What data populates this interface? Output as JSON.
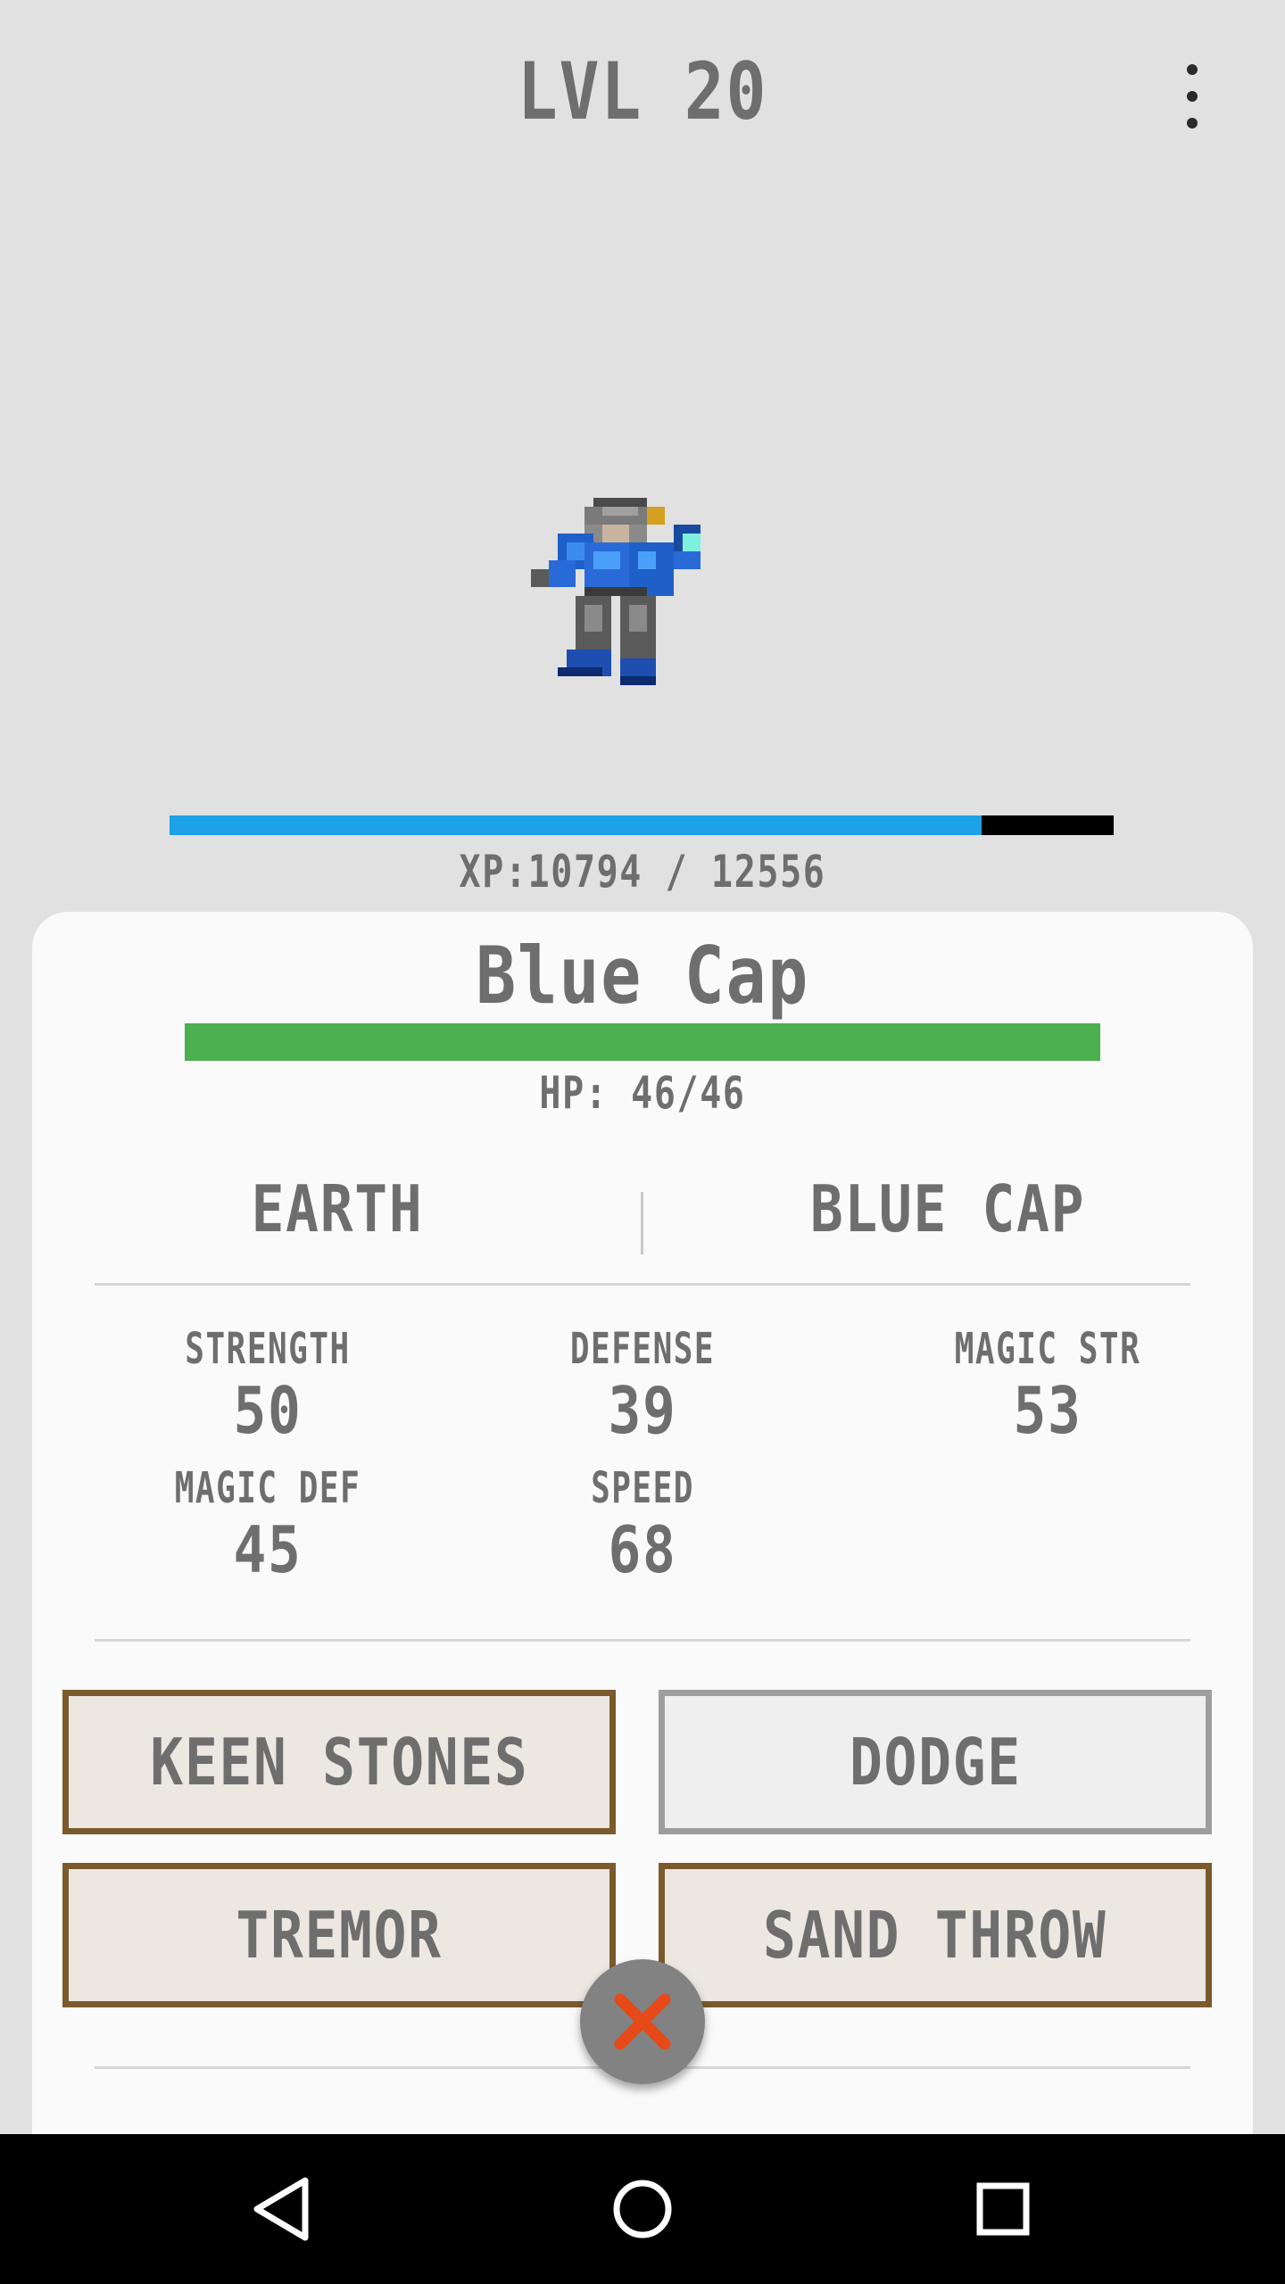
{
  "header": {
    "level_label": "LVL 20",
    "menu_icon": "more-vert-icon"
  },
  "monster": {
    "sprite_icon": "blue-cap-sprite",
    "xp_text": "XP:10794 / 12556",
    "xp_current": 10794,
    "xp_max": 12556,
    "name": "Blue Cap",
    "hp_text": "HP: 46/46",
    "hp_current": 46,
    "hp_max": 46,
    "type": "EARTH",
    "species": "BLUE CAP"
  },
  "stats": [
    {
      "label": "STRENGTH",
      "value": "50"
    },
    {
      "label": "DEFENSE",
      "value": "39"
    },
    {
      "label": "MAGIC STR",
      "value": "53"
    },
    {
      "label": "MAGIC DEF",
      "value": "45"
    },
    {
      "label": "SPEED",
      "value": "68"
    }
  ],
  "moves": [
    {
      "label": "KEEN STONES",
      "state": "available"
    },
    {
      "label": "DODGE",
      "state": "inactive"
    },
    {
      "label": "TREMOR",
      "state": "available"
    },
    {
      "label": "SAND THROW",
      "state": "available"
    }
  ],
  "close_button": {
    "icon": "close-icon"
  },
  "nav_bar": {
    "back_icon": "back-icon",
    "home_icon": "home-icon",
    "recents_icon": "recents-icon"
  },
  "colors": {
    "background": "#e1e1e1",
    "xp_bar": "#1ea1e6",
    "hp_bar": "#4caf50",
    "move_border": "#7b5a2e",
    "close_x": "#e64a19"
  }
}
